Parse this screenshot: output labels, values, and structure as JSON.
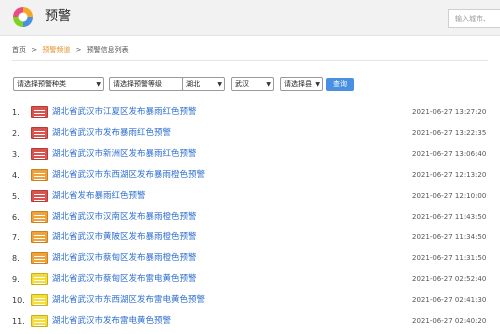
{
  "header": {
    "title": "预警",
    "search_placeholder": "输入城市、"
  },
  "breadcrumb": {
    "home": "首页",
    "sep": ">",
    "current_section": "预警频道",
    "page": "预警信息列表"
  },
  "filters": {
    "type": "请选择预警种类",
    "level": "请选择预警等级",
    "province": "湖北",
    "city": "武汉",
    "county": "请选择县",
    "query_label": "查询"
  },
  "colors": {
    "link": "#2f6fd0",
    "red_alert": "#d9534f",
    "orange_alert": "#f0a23a",
    "yellow_alert": "#f3dd3c",
    "query_button": "#4a90e2",
    "breadcrumb_active": "#e8902a"
  },
  "warnings": [
    {
      "index": "1.",
      "level": "red",
      "title": "湖北省武汉市江夏区发布暴雨红色预警",
      "time": "2021-06-27 13:27:20"
    },
    {
      "index": "2.",
      "level": "red",
      "title": "湖北省武汉市发布暴雨红色预警",
      "time": "2021-06-27 13:22:35"
    },
    {
      "index": "3.",
      "level": "red",
      "title": "湖北省武汉市新洲区发布暴雨红色预警",
      "time": "2021-06-27 13:06:40"
    },
    {
      "index": "4.",
      "level": "orange",
      "title": "湖北省武汉市东西湖区发布暴雨橙色预警",
      "time": "2021-06-27 12:13:20"
    },
    {
      "index": "5.",
      "level": "red",
      "title": "湖北省发布暴雨红色预警",
      "time": "2021-06-27 12:10:00"
    },
    {
      "index": "6.",
      "level": "orange",
      "title": "湖北省武汉市汉南区发布暴雨橙色预警",
      "time": "2021-06-27 11:43:50"
    },
    {
      "index": "7.",
      "level": "orange",
      "title": "湖北省武汉市黄陂区发布暴雨橙色预警",
      "time": "2021-06-27 11:34:50"
    },
    {
      "index": "8.",
      "level": "orange",
      "title": "湖北省武汉市蔡甸区发布暴雨橙色预警",
      "time": "2021-06-27 11:31:50"
    },
    {
      "index": "9.",
      "level": "yellow",
      "title": "湖北省武汉市蔡甸区发布雷电黄色预警",
      "time": "2021-06-27 02:52:40"
    },
    {
      "index": "10.",
      "level": "yellow",
      "title": "湖北省武汉市东西湖区发布雷电黄色预警",
      "time": "2021-06-27 02:41:30"
    },
    {
      "index": "11.",
      "level": "yellow",
      "title": "湖北省武汉市发布雷电黄色预警",
      "time": "2021-06-27 02:40:20"
    }
  ]
}
